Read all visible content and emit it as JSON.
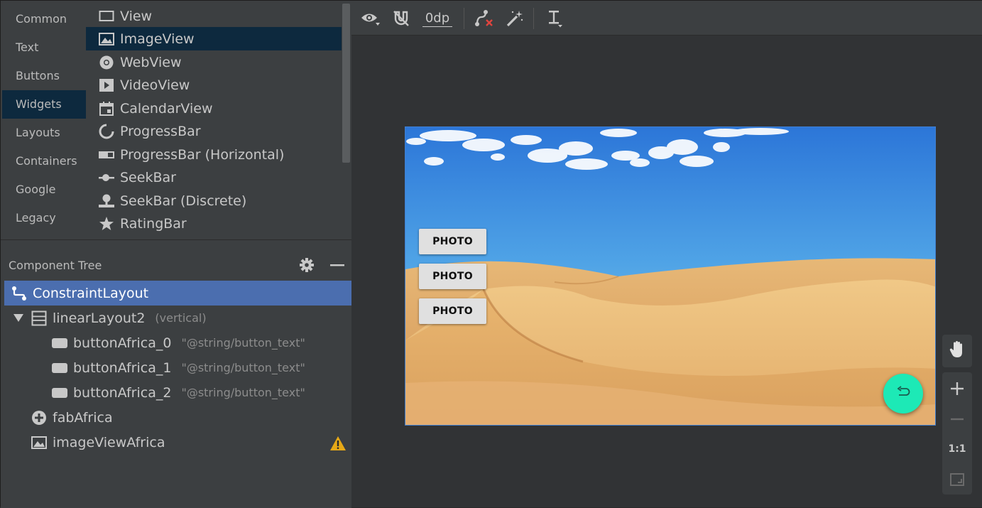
{
  "palette": {
    "categories": [
      {
        "label": "Common"
      },
      {
        "label": "Text"
      },
      {
        "label": "Buttons"
      },
      {
        "label": "Widgets",
        "selected": true
      },
      {
        "label": "Layouts"
      },
      {
        "label": "Containers"
      },
      {
        "label": "Google"
      },
      {
        "label": "Legacy"
      }
    ],
    "widgets": [
      {
        "label": "View",
        "icon": "view-icon"
      },
      {
        "label": "ImageView",
        "icon": "image-icon",
        "selected": true
      },
      {
        "label": "WebView",
        "icon": "globe-icon"
      },
      {
        "label": "VideoView",
        "icon": "play-icon"
      },
      {
        "label": "CalendarView",
        "icon": "calendar-icon"
      },
      {
        "label": "ProgressBar",
        "icon": "progress-circle-icon"
      },
      {
        "label": "ProgressBar (Horizontal)",
        "icon": "progress-bar-icon"
      },
      {
        "label": "SeekBar",
        "icon": "seekbar-icon"
      },
      {
        "label": "SeekBar (Discrete)",
        "icon": "seekbar-discrete-icon"
      },
      {
        "label": "RatingBar",
        "icon": "star-icon"
      }
    ]
  },
  "component_tree": {
    "title": "Component Tree",
    "nodes": [
      {
        "label": "ConstraintLayout",
        "hint": "",
        "icon": "constraint-layout-icon"
      },
      {
        "label": "linearLayout2",
        "hint": "(vertical)",
        "icon": "linear-layout-icon"
      },
      {
        "label": "buttonAfrica_0",
        "hint": "\"@string/button_text\"",
        "icon": "button-icon"
      },
      {
        "label": "buttonAfrica_1",
        "hint": "\"@string/button_text\"",
        "icon": "button-icon"
      },
      {
        "label": "buttonAfrica_2",
        "hint": "\"@string/button_text\"",
        "icon": "button-icon"
      },
      {
        "label": "fabAfrica",
        "hint": "",
        "icon": "fab-icon"
      },
      {
        "label": "imageViewAfrica",
        "hint": "",
        "icon": "image-icon"
      }
    ]
  },
  "toolbar": {
    "default_margin": "0dp"
  },
  "preview": {
    "buttons": [
      "PHOTO",
      "PHOTO",
      "PHOTO"
    ]
  },
  "zoom": {
    "one_to_one": "1:1"
  },
  "colors": {
    "accent_fab": "#1de9b6",
    "selection": "#4b6eaf",
    "palette_selection": "#0d293e",
    "warning": "#e6a817"
  }
}
